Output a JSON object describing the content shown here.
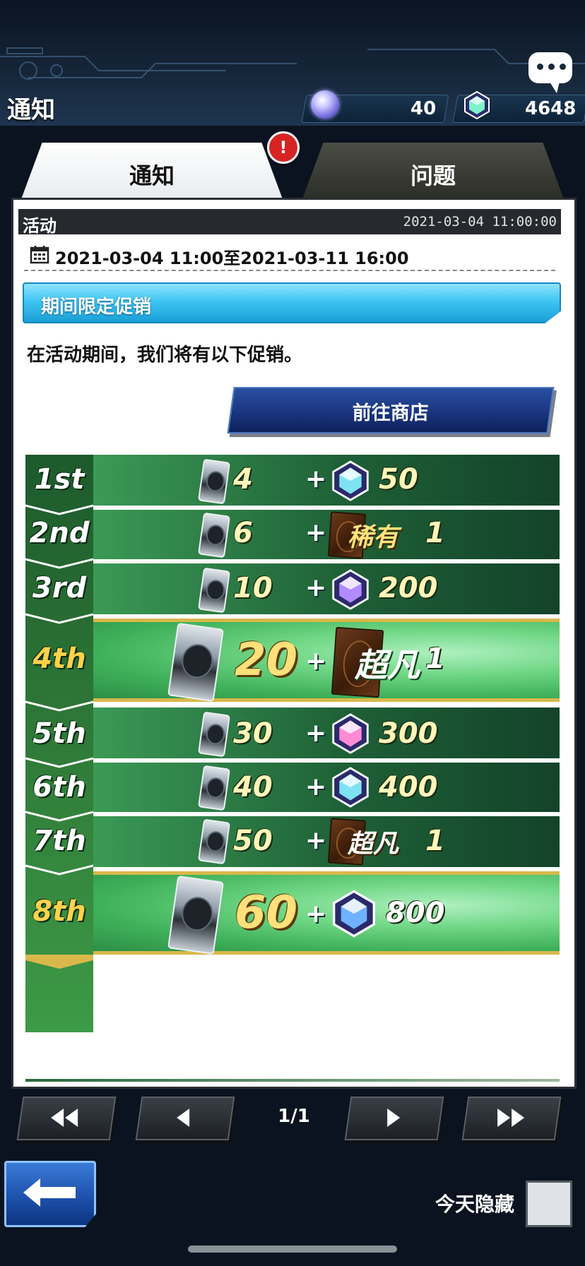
{
  "header": {
    "title": "通知",
    "currency_orbs": "40",
    "currency_gems": "4648"
  },
  "tabs": [
    {
      "label": "通知",
      "active": true,
      "alert": "!"
    },
    {
      "label": "问题",
      "active": false
    }
  ],
  "notice": {
    "category": "活动",
    "posted": "2021-03-04 11:00:00",
    "period": "2021-03-04 11:00至2021-03-11 16:00",
    "section_title": "期间限定促销",
    "intro": "在活动期间，我们将有以下促销。",
    "shop_button": "前往商店"
  },
  "rewards": [
    {
      "rank": "1st",
      "packs": "4",
      "bonus": "50",
      "bonus_type": "gem-icon"
    },
    {
      "rank": "2nd",
      "packs": "6",
      "bonus": "稀有",
      "bonus_count": "1",
      "bonus_type": "card-back-icon"
    },
    {
      "rank": "3rd",
      "packs": "10",
      "bonus": "200",
      "bonus_type": "gem-icon"
    },
    {
      "rank": "4th",
      "packs": "20",
      "bonus": "超凡",
      "bonus_count": "1",
      "bonus_type": "card-back-icon",
      "highlight": true
    },
    {
      "rank": "5th",
      "packs": "30",
      "bonus": "300",
      "bonus_type": "gem-icon"
    },
    {
      "rank": "6th",
      "packs": "40",
      "bonus": "400",
      "bonus_type": "gem-icon"
    },
    {
      "rank": "7th",
      "packs": "50",
      "bonus": "超凡",
      "bonus_count": "1",
      "bonus_type": "card-back-icon"
    },
    {
      "rank": "8th",
      "packs": "60",
      "bonus": "800",
      "bonus_type": "gem-icon",
      "highlight": true
    }
  ],
  "plus_sign": "+",
  "pager": {
    "text": "1/1"
  },
  "footer": {
    "hide_today": "今天隐藏"
  },
  "colors": {
    "brand_blue": "#1a3680",
    "section_cyan": "#3ec5f2",
    "reward_green": "#2c8e46",
    "gold_trim": "#d8b84a",
    "alert_red": "#d62424"
  }
}
